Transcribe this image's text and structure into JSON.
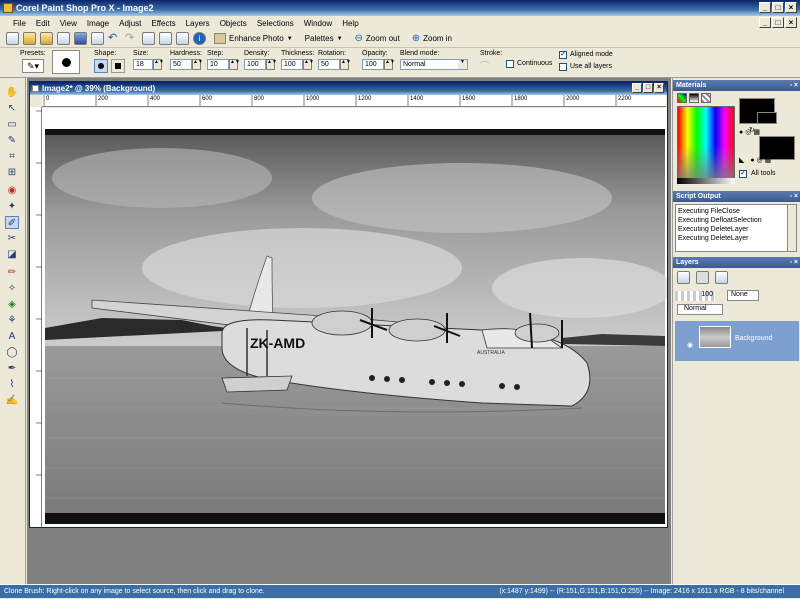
{
  "window": {
    "title": "Corel Paint Shop Pro X - Image2"
  },
  "menu": {
    "items": [
      "File",
      "Edit",
      "View",
      "Image",
      "Adjust",
      "Effects",
      "Layers",
      "Objects",
      "Selections",
      "Window",
      "Help"
    ]
  },
  "toolbar": {
    "enhance_photo": "Enhance Photo",
    "palettes": "Palettes",
    "zoom_out": "Zoom out",
    "zoom_in": "Zoom in"
  },
  "tool_options": {
    "presets_label": "Presets:",
    "shape_label": "Shape:",
    "size_label": "Size:",
    "size_value": "18",
    "hardness_label": "Hardness:",
    "hardness_value": "50",
    "step_label": "Step:",
    "step_value": "10",
    "density_label": "Density:",
    "density_value": "100",
    "thickness_label": "Thickness:",
    "thickness_value": "100",
    "rotation_label": "Rotation:",
    "rotation_value": "50",
    "opacity_label": "Opacity:",
    "opacity_value": "100",
    "blend_label": "Blend mode:",
    "blend_value": "Normal",
    "stroke_label": "Stroke:",
    "continuous_label": "Continuous",
    "aligned_label": "Aligned mode",
    "all_layers_label": "Use all layers"
  },
  "image_window": {
    "title": "Image2* @ 39% (Background)",
    "ruler_ticks": [
      "0",
      "200",
      "400",
      "600",
      "800",
      "1000",
      "1200",
      "1400",
      "1600",
      "1800",
      "2000",
      "2200"
    ],
    "plane_text": "ZK-AMD",
    "plane_text2": "AUSTRALIA"
  },
  "materials": {
    "title": "Materials",
    "all_tools": "All tools"
  },
  "script_output": {
    "title": "Script Output",
    "lines": [
      "Executing FileClose",
      "Executing DefloatSelection",
      "Executing DeleteLayer",
      "Executing DeleteLayer"
    ]
  },
  "layers": {
    "title": "Layers",
    "opacity": "100",
    "none_label": "None",
    "blend": "Normal",
    "layer_name": "Background"
  },
  "status": {
    "text": "Clone Brush: Right-click on any image to select source, then click and drag to clone.",
    "info": "(x:1487 y:1499) -- (R:151,G:151,B:151,O:255) -- Image:  2416 x 1611 x RGB - 8 bits/channel"
  },
  "colors": {
    "title_bar": "#0a246a",
    "panel_header": "#3a5a90",
    "workspace": "#808080",
    "status_bar": "#3a6ea5"
  }
}
